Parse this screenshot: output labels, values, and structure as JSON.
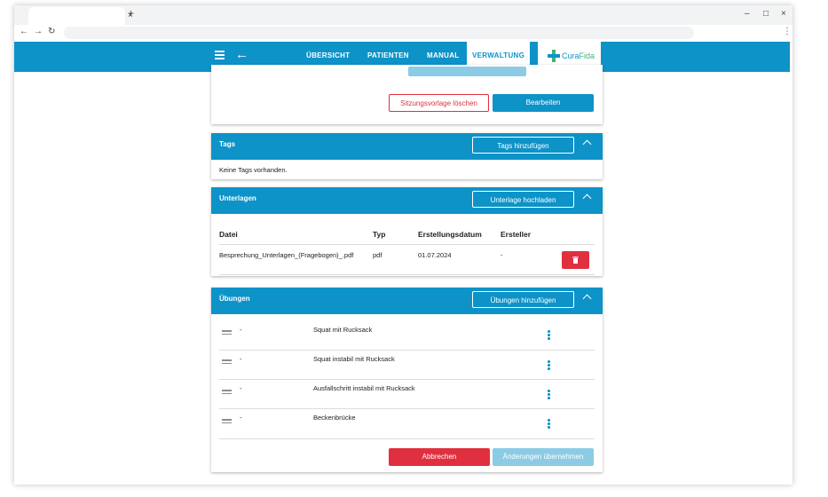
{
  "browser": {
    "tab_close": "×",
    "new_tab": "+",
    "minimize": "–",
    "maximize": "□",
    "close": "×",
    "back": "←",
    "forward": "→",
    "reload": "↻",
    "menu": "⋮"
  },
  "nav": {
    "back_icon": "←",
    "links": [
      "ÜBERSICHT",
      "PATIENTEN",
      "MANUAL",
      "VERWALTUNG"
    ],
    "active": "VERWALTUNG",
    "logo": {
      "part1": "Cura",
      "part2": "Fida"
    }
  },
  "session_card": {
    "delete_label": "Sitzungsvorlage löschen",
    "edit_label": "Bearbeiten"
  },
  "tags": {
    "title": "Tags",
    "add_label": "Tags hinzufügen",
    "empty_text": "Keine Tags vorhanden."
  },
  "documents": {
    "title": "Unterlagen",
    "upload_label": "Unterlage hochladen",
    "columns": [
      "Datei",
      "Typ",
      "Erstellungsdatum",
      "Ersteller"
    ],
    "rows": [
      {
        "file": "Besprechung_Unterlagen_(Fragebogen)_.pdf",
        "type": "pdf",
        "date": "01.07.2024",
        "creator": "-"
      }
    ]
  },
  "exercises": {
    "title": "Übungen",
    "add_label": "Übungen hinzufügen",
    "items": [
      {
        "prefix": "-",
        "name": "Squat mit Rucksack"
      },
      {
        "prefix": "-",
        "name": "Squat instabil mit Rucksack"
      },
      {
        "prefix": "-",
        "name": "Ausfallschritt instabil mit Rucksack"
      },
      {
        "prefix": "-",
        "name": "Beckenbrücke"
      }
    ],
    "cancel_label": "Abbrechen",
    "apply_label": "Änderungen übernehmen"
  },
  "colors": {
    "primary": "#0d93c8",
    "danger": "#e0303f",
    "accent_green": "#3fb37a",
    "disabled_blue": "#8ccbe6"
  }
}
